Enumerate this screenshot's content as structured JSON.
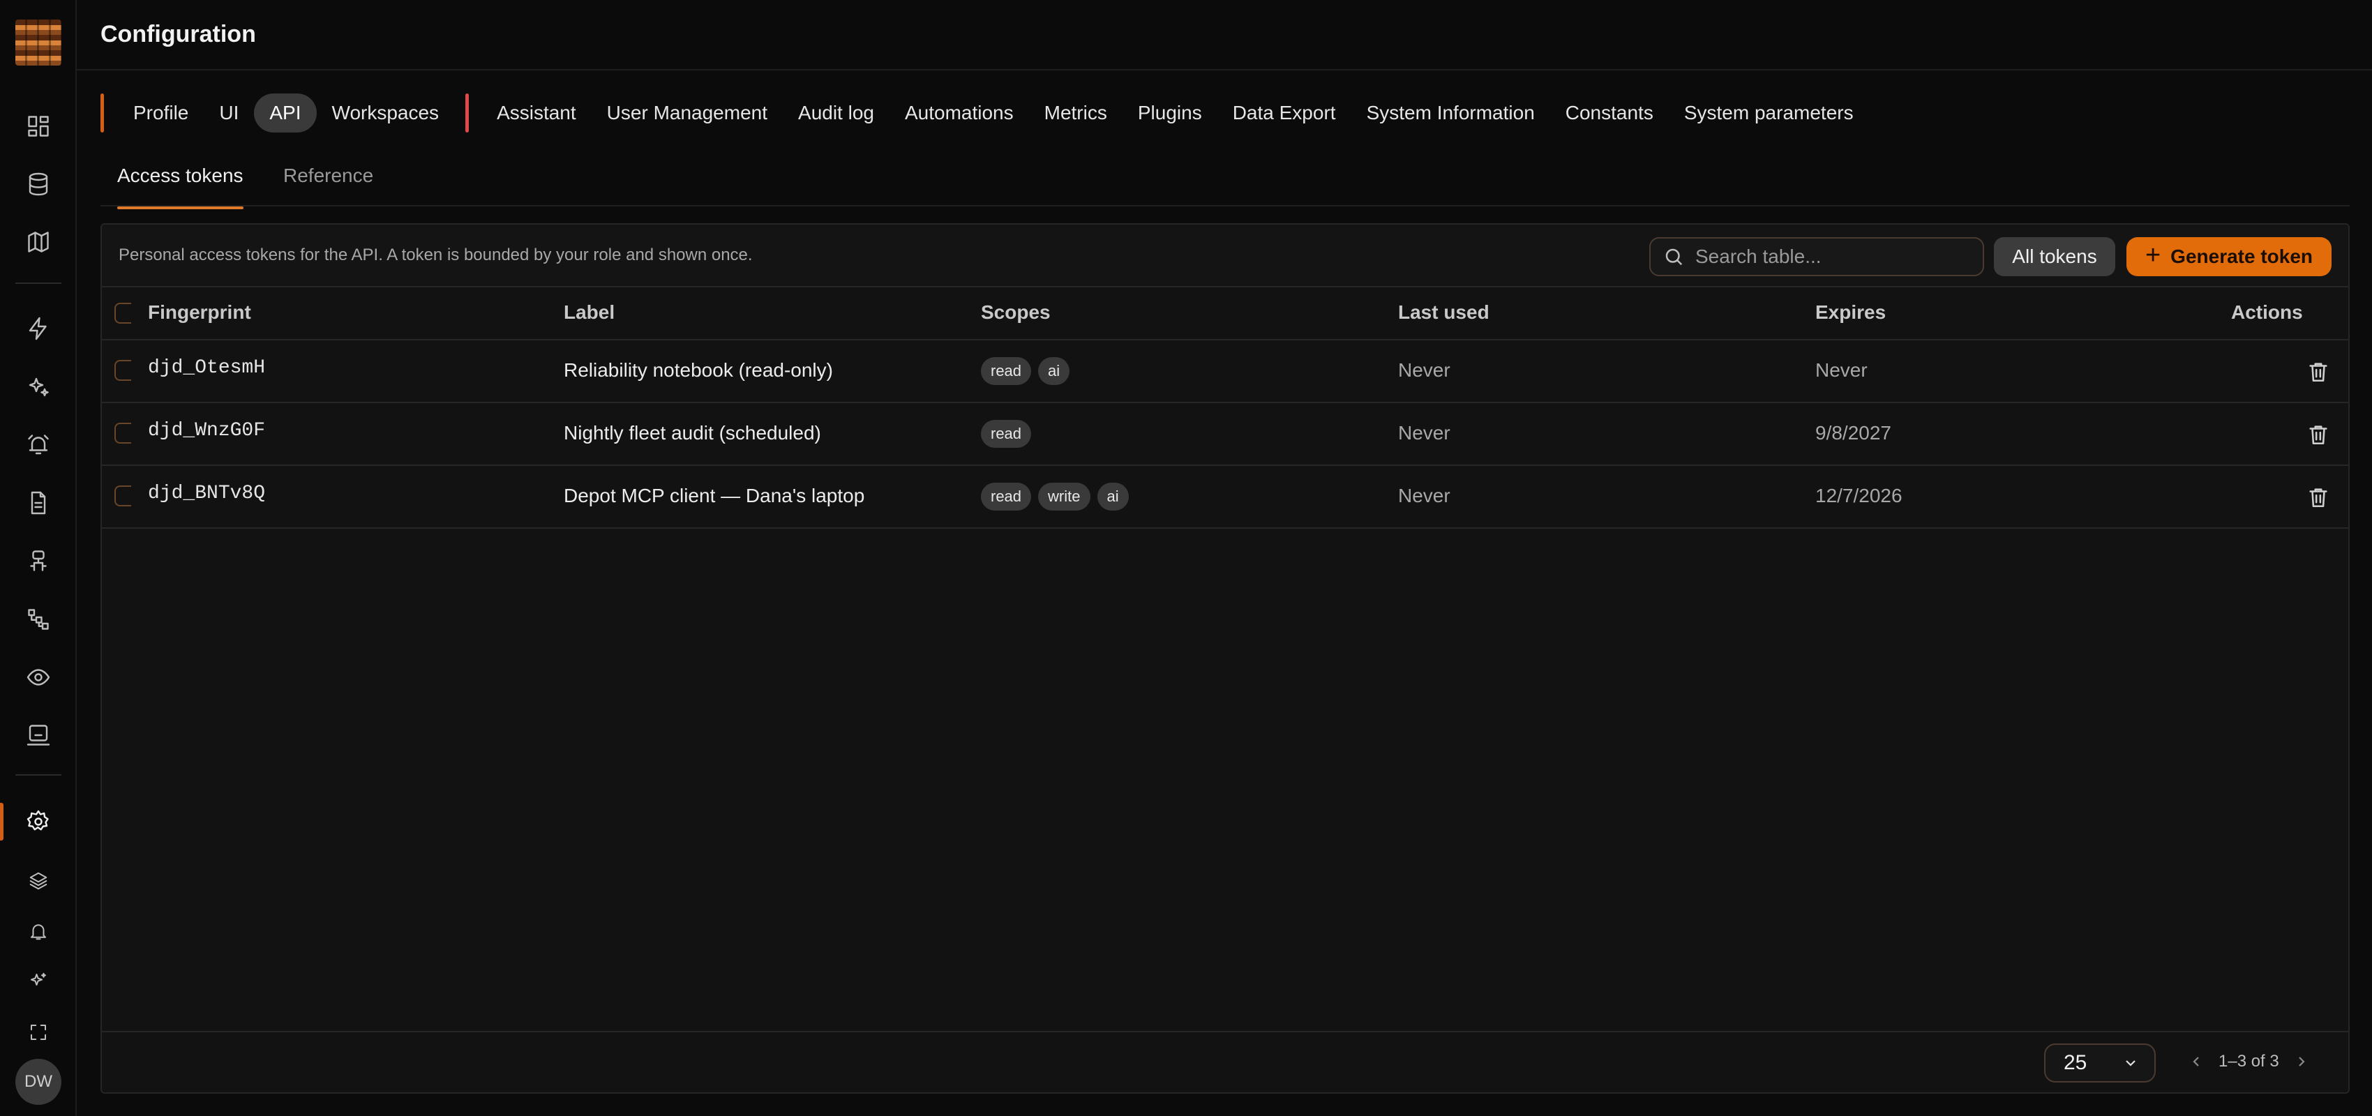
{
  "header": {
    "title": "Configuration"
  },
  "rail": {
    "icons": [
      "dashboard-icon",
      "database-icon",
      "map-icon",
      "lightning-icon",
      "sparkles-icon",
      "alarm-icon",
      "document-icon",
      "robot-icon",
      "workflow-icon",
      "eye-icon",
      "terminal-icon",
      "settings-icon",
      "layers-icon",
      "bell-icon",
      "ai-sparkle-icon",
      "fullscreen-icon"
    ],
    "avatar_initials": "DW"
  },
  "main_tabs": [
    "Profile",
    "UI",
    "API",
    "Workspaces",
    "Assistant",
    "User Management",
    "Audit log",
    "Automations",
    "Metrics",
    "Plugins",
    "Data Export",
    "System Information",
    "Constants",
    "System parameters"
  ],
  "main_tabs_active": "API",
  "sub_tabs": {
    "access_tokens": "Access tokens",
    "reference": "Reference"
  },
  "toolbar": {
    "description": "Personal access tokens for the API. A token is bounded by your role and shown once.",
    "search_placeholder": "Search table...",
    "filter_label": "All tokens",
    "generate_label": "Generate token"
  },
  "table": {
    "columns": {
      "fingerprint": "Fingerprint",
      "label": "Label",
      "scopes": "Scopes",
      "last_used": "Last used",
      "expires": "Expires",
      "actions": "Actions"
    },
    "rows": [
      {
        "fingerprint": "djd_OtesmH",
        "label": "Reliability notebook (read-only)",
        "scopes": [
          "read",
          "ai"
        ],
        "last_used": "Never",
        "expires": "Never"
      },
      {
        "fingerprint": "djd_WnzG0F",
        "label": "Nightly fleet audit (scheduled)",
        "scopes": [
          "read"
        ],
        "last_used": "Never",
        "expires": "9/8/2027"
      },
      {
        "fingerprint": "djd_BNTv8Q",
        "label": "Depot MCP client — Dana's laptop",
        "scopes": [
          "read",
          "write",
          "ai"
        ],
        "last_used": "Never",
        "expires": "12/7/2026"
      }
    ]
  },
  "footer": {
    "page_size": "25",
    "range": "1–3 of 3"
  },
  "colors": {
    "accent": "#e36c0a",
    "background": "#0b0b0b",
    "panel": "#121212"
  }
}
